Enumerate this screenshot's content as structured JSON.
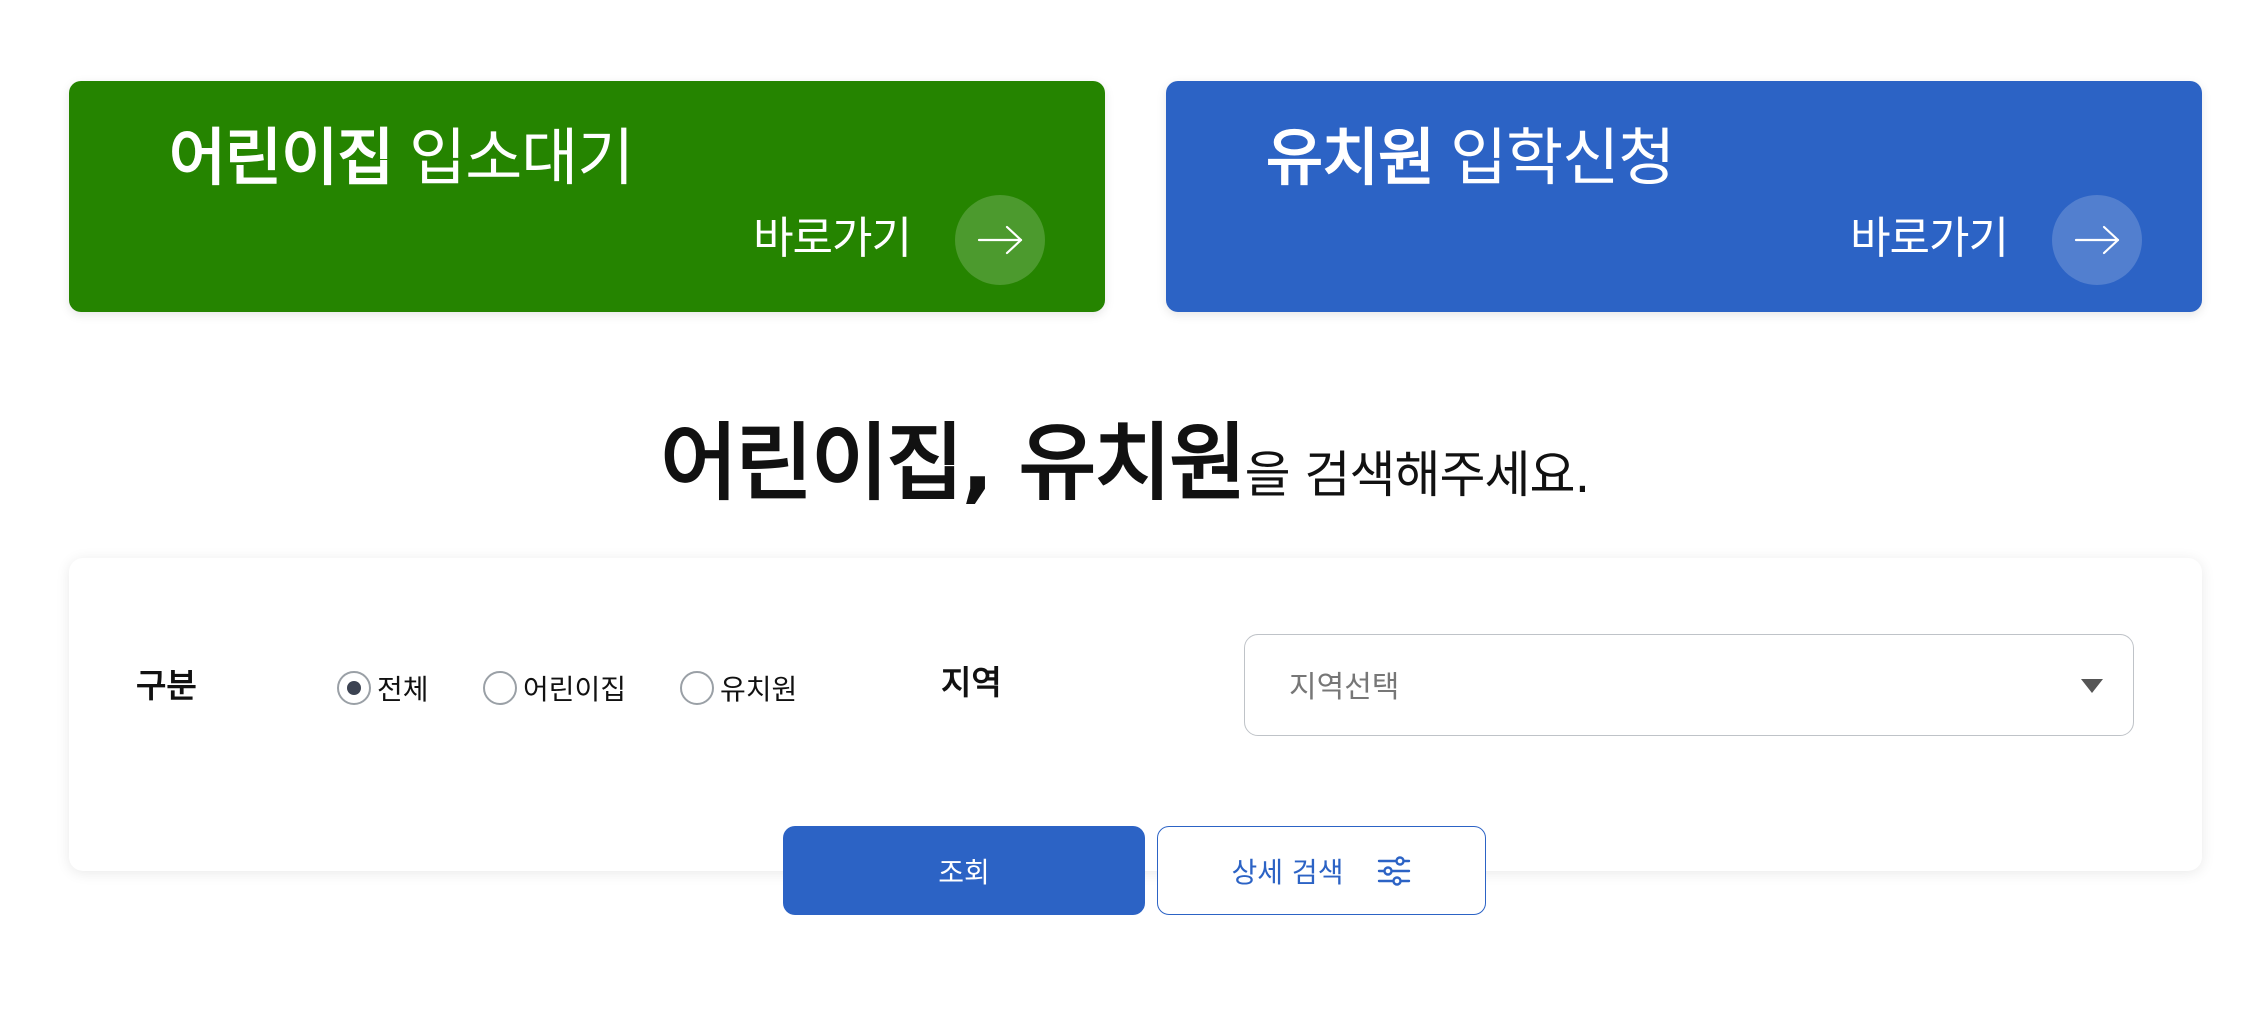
{
  "banners": {
    "daycare": {
      "title_strong": "어린이집",
      "title_light": "입소대기",
      "link_label": "바로가기",
      "color": "#258400"
    },
    "kindergarten": {
      "title_strong": "유치원",
      "title_light": "입학신청",
      "link_label": "바로가기",
      "color": "#2c63c5"
    }
  },
  "headline": {
    "strong": "어린이집, 유치원",
    "light": "을 검색해주세요."
  },
  "search": {
    "category_label": "구분",
    "options": [
      {
        "label": "전체",
        "selected": true
      },
      {
        "label": "어린이집",
        "selected": false
      },
      {
        "label": "유치원",
        "selected": false
      }
    ],
    "region_label": "지역",
    "region_value": "지역선택"
  },
  "buttons": {
    "search_label": "조회",
    "advanced_label": "상세 검색"
  },
  "icons": {
    "banner_arrow": "arrow-right-icon",
    "select_caret": "caret-down-icon",
    "filter": "sliders-icon"
  },
  "colors": {
    "primary": "#2c63c5",
    "green": "#258400"
  }
}
